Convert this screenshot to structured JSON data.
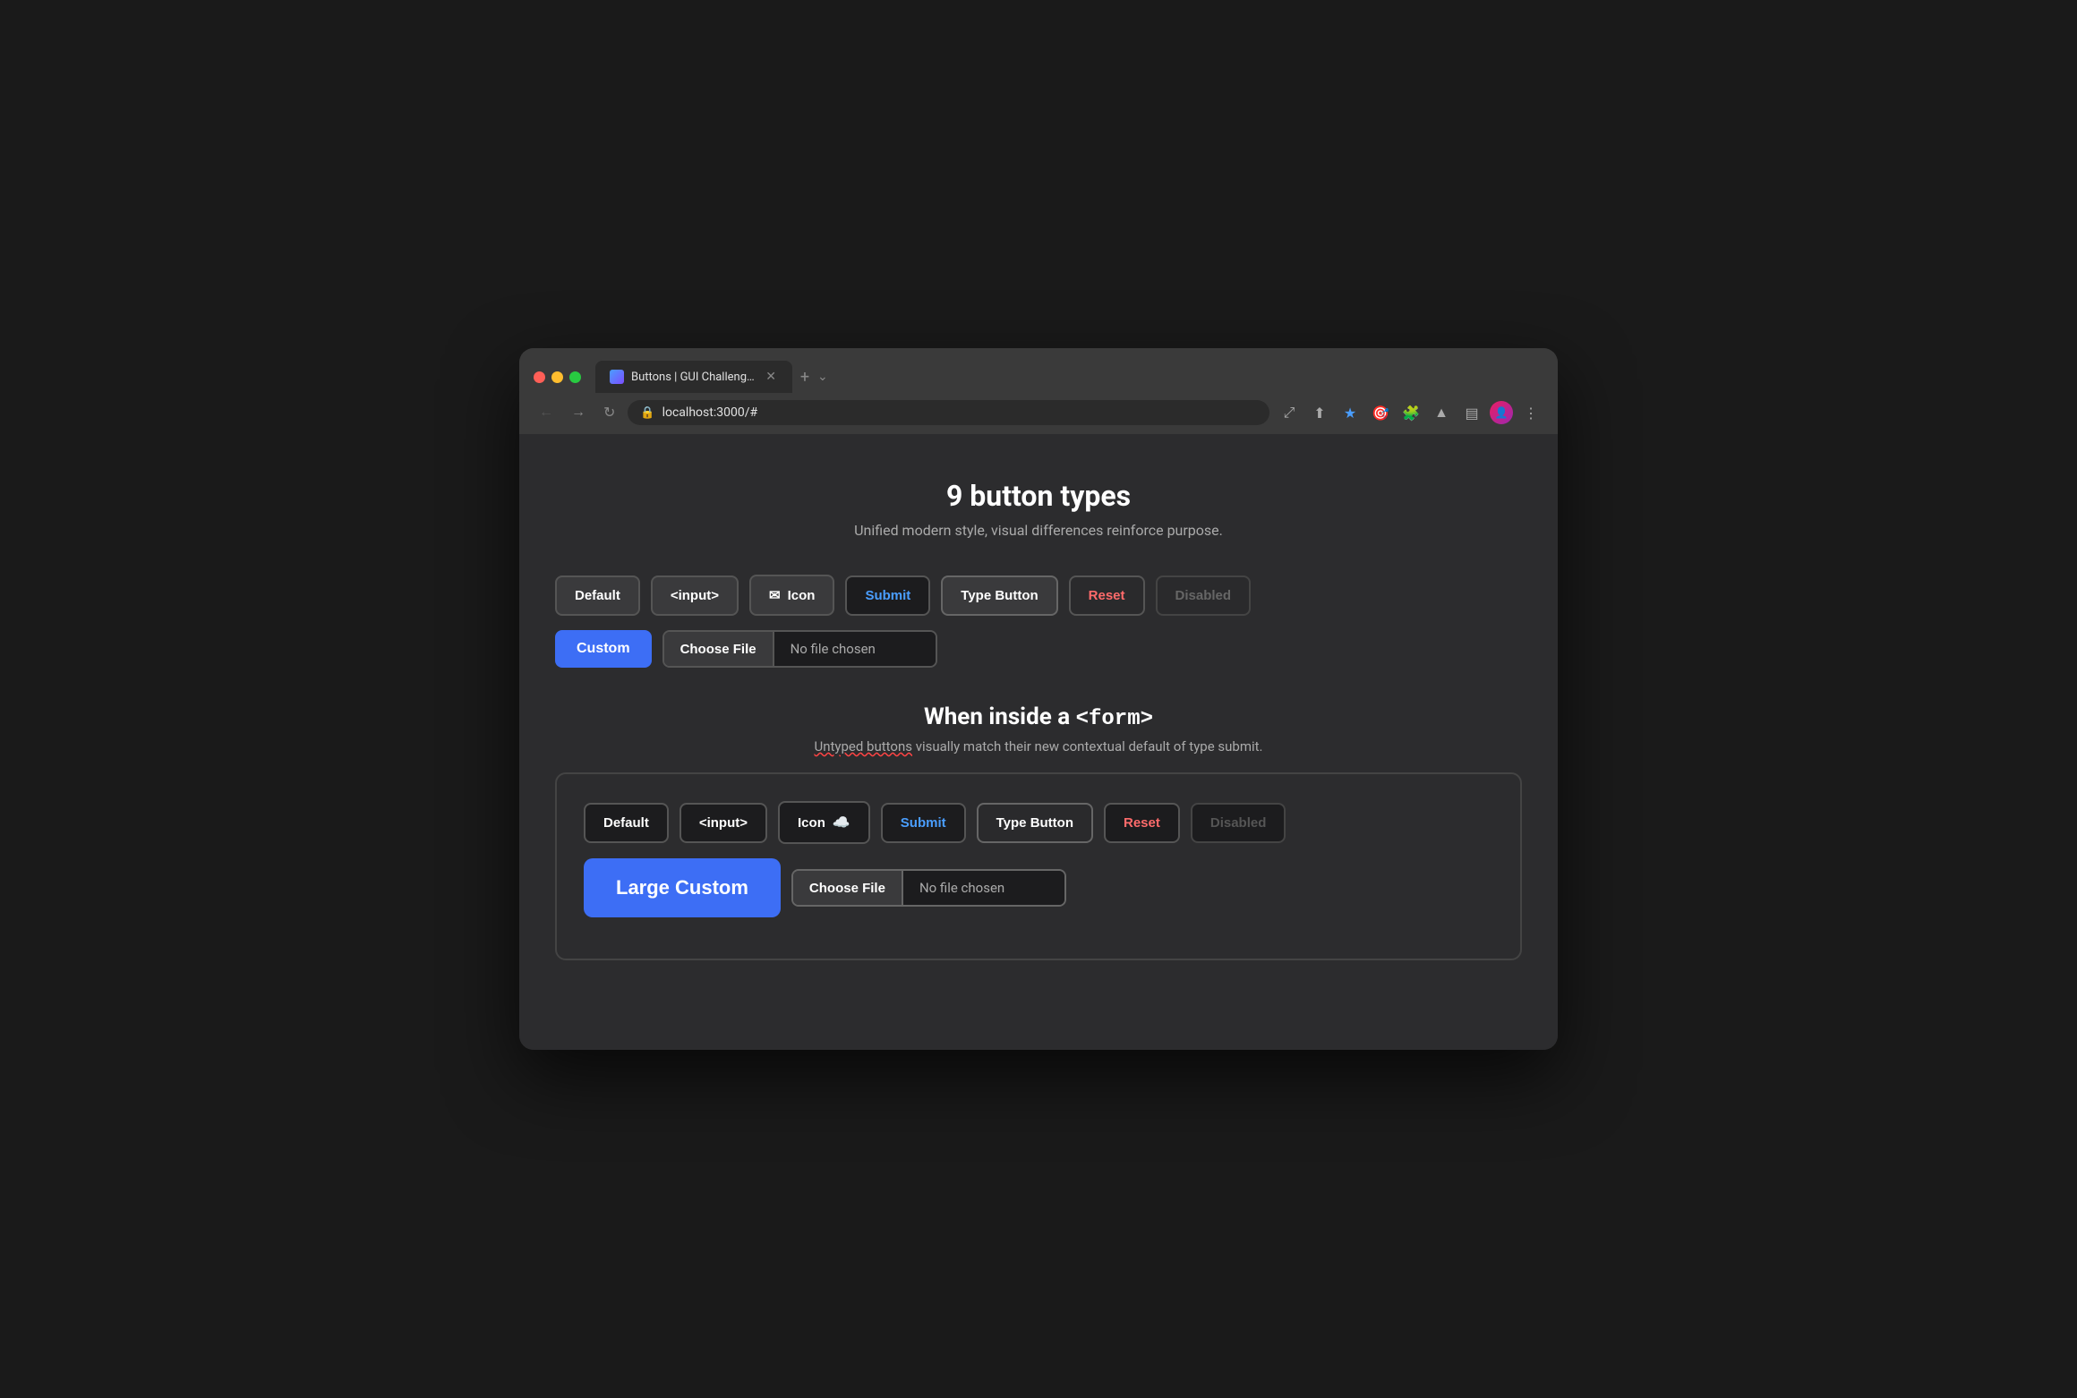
{
  "browser": {
    "tab_title": "Buttons | GUI Challenges",
    "url": "localhost:3000/#",
    "traffic_lights": {
      "red": "close",
      "yellow": "minimize",
      "green": "maximize"
    }
  },
  "page": {
    "title": "9 button types",
    "subtitle": "Unified modern style, visual differences reinforce purpose.",
    "section1": {
      "buttons": {
        "default_label": "Default",
        "input_label": "<input>",
        "icon_label": "Icon",
        "submit_label": "Submit",
        "type_button_label": "Type Button",
        "reset_label": "Reset",
        "disabled_label": "Disabled",
        "custom_label": "Custom",
        "file_choose_label": "Choose File",
        "file_no_chosen_label": "No file chosen"
      }
    },
    "section2": {
      "title_prefix": "When inside a ",
      "title_code": "<form>",
      "subtitle_part1": "Untyped buttons",
      "subtitle_part2": " visually match their new contextual default of type submit.",
      "buttons": {
        "default_label": "Default",
        "input_label": "<input>",
        "icon_label": "Icon",
        "submit_label": "Submit",
        "type_button_label": "Type Button",
        "reset_label": "Reset",
        "disabled_label": "Disabled",
        "large_custom_label": "Large Custom",
        "file_choose_label": "Choose File",
        "file_no_chosen_label": "No file chosen"
      }
    }
  }
}
